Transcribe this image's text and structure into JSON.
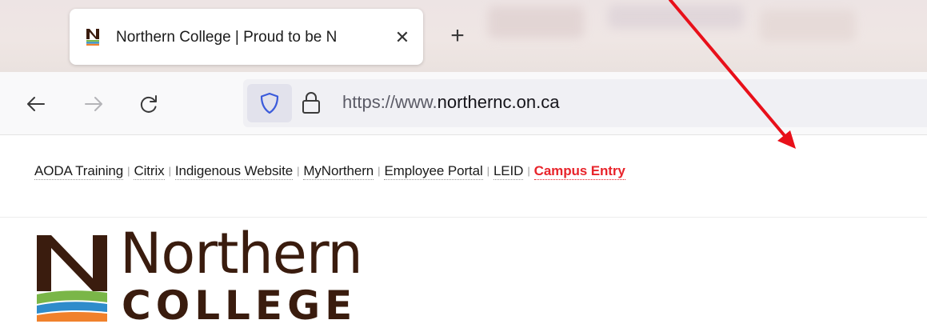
{
  "browser": {
    "tab": {
      "title": "Northern College | Proud to be N",
      "close_glyph": "✕",
      "favicon_icon": "northern-college-favicon"
    },
    "new_tab_glyph": "+",
    "nav": {
      "back_icon": "back-arrow-icon",
      "forward_icon": "forward-arrow-icon",
      "reload_icon": "reload-icon"
    },
    "urlbar": {
      "shield_icon": "tracking-protection-shield-icon",
      "lock_icon": "lock-icon",
      "url_prefix": "https://www.",
      "url_domain": "northernc.on.ca"
    }
  },
  "page": {
    "quick_links": [
      {
        "label": "AODA Training"
      },
      {
        "label": "Citrix"
      },
      {
        "label": "Indigenous Website"
      },
      {
        "label": "MyNorthern"
      },
      {
        "label": "Employee Portal"
      },
      {
        "label": "LEID"
      },
      {
        "label": "Campus Entry",
        "emphasis": true
      }
    ],
    "separator": "|",
    "logo": {
      "line1": "Northern",
      "line2": "COLLEGE"
    }
  },
  "colors": {
    "emphasis_link": "#e8242b",
    "logo_brown": "#3a1c0e",
    "logo_green": "#7ab648",
    "logo_blue": "#2f8ccb",
    "logo_orange": "#f0812c",
    "annotation_arrow": "#e8101a"
  },
  "annotation": {
    "type": "arrow",
    "points_to": "Campus Entry"
  }
}
